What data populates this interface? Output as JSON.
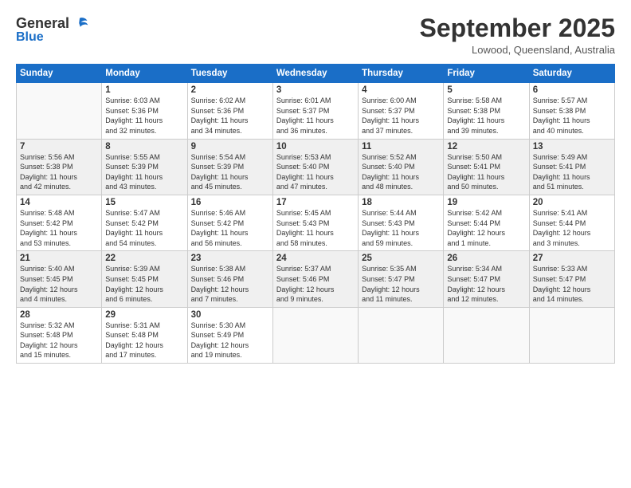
{
  "header": {
    "logo": {
      "general": "General",
      "blue": "Blue"
    },
    "title": "September 2025",
    "location": "Lowood, Queensland, Australia"
  },
  "days_of_week": [
    "Sunday",
    "Monday",
    "Tuesday",
    "Wednesday",
    "Thursday",
    "Friday",
    "Saturday"
  ],
  "weeks": [
    [
      {
        "day": "",
        "info": ""
      },
      {
        "day": "1",
        "info": "Sunrise: 6:03 AM\nSunset: 5:36 PM\nDaylight: 11 hours\nand 32 minutes."
      },
      {
        "day": "2",
        "info": "Sunrise: 6:02 AM\nSunset: 5:36 PM\nDaylight: 11 hours\nand 34 minutes."
      },
      {
        "day": "3",
        "info": "Sunrise: 6:01 AM\nSunset: 5:37 PM\nDaylight: 11 hours\nand 36 minutes."
      },
      {
        "day": "4",
        "info": "Sunrise: 6:00 AM\nSunset: 5:37 PM\nDaylight: 11 hours\nand 37 minutes."
      },
      {
        "day": "5",
        "info": "Sunrise: 5:58 AM\nSunset: 5:38 PM\nDaylight: 11 hours\nand 39 minutes."
      },
      {
        "day": "6",
        "info": "Sunrise: 5:57 AM\nSunset: 5:38 PM\nDaylight: 11 hours\nand 40 minutes."
      }
    ],
    [
      {
        "day": "7",
        "info": "Sunrise: 5:56 AM\nSunset: 5:38 PM\nDaylight: 11 hours\nand 42 minutes."
      },
      {
        "day": "8",
        "info": "Sunrise: 5:55 AM\nSunset: 5:39 PM\nDaylight: 11 hours\nand 43 minutes."
      },
      {
        "day": "9",
        "info": "Sunrise: 5:54 AM\nSunset: 5:39 PM\nDaylight: 11 hours\nand 45 minutes."
      },
      {
        "day": "10",
        "info": "Sunrise: 5:53 AM\nSunset: 5:40 PM\nDaylight: 11 hours\nand 47 minutes."
      },
      {
        "day": "11",
        "info": "Sunrise: 5:52 AM\nSunset: 5:40 PM\nDaylight: 11 hours\nand 48 minutes."
      },
      {
        "day": "12",
        "info": "Sunrise: 5:50 AM\nSunset: 5:41 PM\nDaylight: 11 hours\nand 50 minutes."
      },
      {
        "day": "13",
        "info": "Sunrise: 5:49 AM\nSunset: 5:41 PM\nDaylight: 11 hours\nand 51 minutes."
      }
    ],
    [
      {
        "day": "14",
        "info": "Sunrise: 5:48 AM\nSunset: 5:42 PM\nDaylight: 11 hours\nand 53 minutes."
      },
      {
        "day": "15",
        "info": "Sunrise: 5:47 AM\nSunset: 5:42 PM\nDaylight: 11 hours\nand 54 minutes."
      },
      {
        "day": "16",
        "info": "Sunrise: 5:46 AM\nSunset: 5:42 PM\nDaylight: 11 hours\nand 56 minutes."
      },
      {
        "day": "17",
        "info": "Sunrise: 5:45 AM\nSunset: 5:43 PM\nDaylight: 11 hours\nand 58 minutes."
      },
      {
        "day": "18",
        "info": "Sunrise: 5:44 AM\nSunset: 5:43 PM\nDaylight: 11 hours\nand 59 minutes."
      },
      {
        "day": "19",
        "info": "Sunrise: 5:42 AM\nSunset: 5:44 PM\nDaylight: 12 hours\nand 1 minute."
      },
      {
        "day": "20",
        "info": "Sunrise: 5:41 AM\nSunset: 5:44 PM\nDaylight: 12 hours\nand 3 minutes."
      }
    ],
    [
      {
        "day": "21",
        "info": "Sunrise: 5:40 AM\nSunset: 5:45 PM\nDaylight: 12 hours\nand 4 minutes."
      },
      {
        "day": "22",
        "info": "Sunrise: 5:39 AM\nSunset: 5:45 PM\nDaylight: 12 hours\nand 6 minutes."
      },
      {
        "day": "23",
        "info": "Sunrise: 5:38 AM\nSunset: 5:46 PM\nDaylight: 12 hours\nand 7 minutes."
      },
      {
        "day": "24",
        "info": "Sunrise: 5:37 AM\nSunset: 5:46 PM\nDaylight: 12 hours\nand 9 minutes."
      },
      {
        "day": "25",
        "info": "Sunrise: 5:35 AM\nSunset: 5:47 PM\nDaylight: 12 hours\nand 11 minutes."
      },
      {
        "day": "26",
        "info": "Sunrise: 5:34 AM\nSunset: 5:47 PM\nDaylight: 12 hours\nand 12 minutes."
      },
      {
        "day": "27",
        "info": "Sunrise: 5:33 AM\nSunset: 5:47 PM\nDaylight: 12 hours\nand 14 minutes."
      }
    ],
    [
      {
        "day": "28",
        "info": "Sunrise: 5:32 AM\nSunset: 5:48 PM\nDaylight: 12 hours\nand 15 minutes."
      },
      {
        "day": "29",
        "info": "Sunrise: 5:31 AM\nSunset: 5:48 PM\nDaylight: 12 hours\nand 17 minutes."
      },
      {
        "day": "30",
        "info": "Sunrise: 5:30 AM\nSunset: 5:49 PM\nDaylight: 12 hours\nand 19 minutes."
      },
      {
        "day": "",
        "info": ""
      },
      {
        "day": "",
        "info": ""
      },
      {
        "day": "",
        "info": ""
      },
      {
        "day": "",
        "info": ""
      }
    ]
  ]
}
